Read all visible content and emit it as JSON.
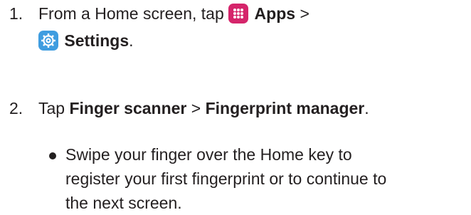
{
  "steps": [
    {
      "number": "1.",
      "line1_prefix": "From a Home screen, tap",
      "apps_label": "Apps",
      "separator": ">",
      "settings_label": "Settings",
      "end": "."
    },
    {
      "number": "2.",
      "prefix": "Tap",
      "item1": "Finger scanner",
      "separator": ">",
      "item2": "Fingerprint manager",
      "end": "."
    }
  ],
  "bullet": {
    "lines": [
      "Swipe your finger over the Home key to",
      "register your first fingerprint or to continue to",
      "the next screen."
    ]
  },
  "icons": {
    "apps": "apps-grid-icon",
    "settings": "settings-gear-icon"
  },
  "colors": {
    "apps_icon_bg": "#d5256b",
    "settings_icon_bg": "#3f9de0",
    "text": "#231f20"
  }
}
